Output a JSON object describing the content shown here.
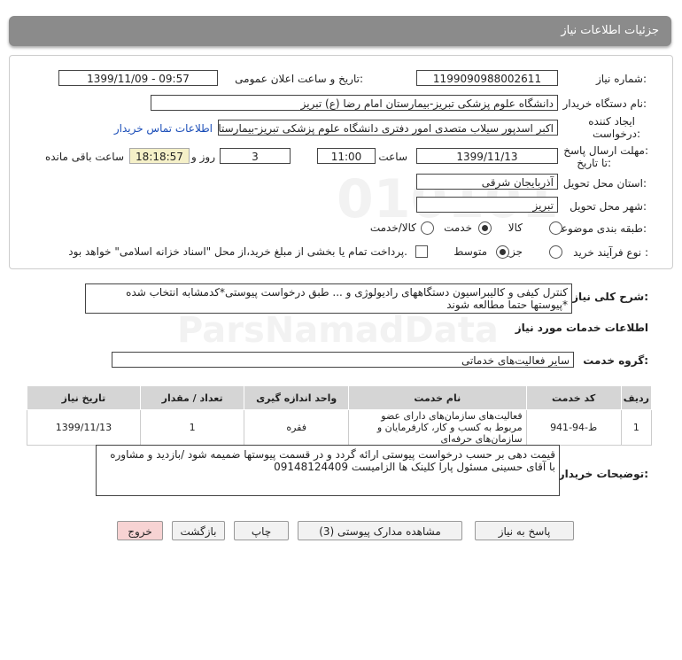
{
  "header": {
    "title": "جزئیات اطلاعات نیاز"
  },
  "fields": {
    "need_number_label": "شماره نیاز:",
    "need_number": "1199090988002611",
    "announce_label": "تاریخ و ساعت اعلان عمومی:",
    "announce_value": "1399/11/09 - 09:57",
    "buyer_label": "نام دستگاه خریدار:",
    "buyer_value": "دانشگاه علوم پزشکی تبریز-بیمارستان امام رضا (ع) تبریز",
    "creator_label_1": "ایجاد کننده",
    "creator_label_2": "درخواست:",
    "creator_value": "اکبر اسدپور سیلاب متصدی امور دفتری دانشگاه علوم پزشکی تبریز-بیمارستان امام",
    "contact_link": "اطلاعات تماس خریدار",
    "deadline_label_1": "مهلت ارسال پاسخ:",
    "deadline_label_2": "تا تاریخ:",
    "deadline_date": "1399/11/13",
    "time_label": "ساعت",
    "deadline_time": "11:00",
    "days_value": "3",
    "days_label": "روز و",
    "remaining_time": "18:18:57",
    "remaining_label": "ساعت باقی مانده",
    "province_label": "استان محل تحویل:",
    "province_value": "آذربایجان شرقی",
    "city_label": "شهر محل تحویل:",
    "city_value": "تبریز",
    "category_label": "طبقه بندی موضوعی:",
    "category_options": [
      "کالا",
      "خدمت",
      "کالا/خدمت"
    ],
    "process_label": "نوع فرآیند خرید :",
    "process_options": [
      "جزیی",
      "متوسط"
    ],
    "payment_text": "پرداخت تمام یا بخشی از مبلغ خرید،از محل \"اسناد خزانه اسلامی\" خواهد بود."
  },
  "description": {
    "label": "شرح کلی نیاز:",
    "line1": "کنترل کیفی و کالیبراسیون دستگاههای رادیولوژی و ... طبق درخواست پیوستی*کدمشابه انتخاب شده",
    "line2": "*پیوستها حتما مطالعه شوند"
  },
  "services_section": "اطلاعات خدمات مورد نیاز",
  "service_group": {
    "label": "گروه خدمت:",
    "value": "سایر فعالیت‌های خدماتی"
  },
  "table": {
    "headers": [
      "ردیف",
      "کد خدمت",
      "نام خدمت",
      "واحد اندازه گیری",
      "تعداد / مقدار",
      "تاریخ نیاز"
    ],
    "rows": [
      [
        "1",
        "ط-94-941",
        "فعالیت‌های سازمان‌های دارای عضو مربوط به کسب و کار، کارفرمایان و سازمان‌های حرفه‌ای",
        "فقره",
        "1",
        "1399/11/13"
      ]
    ]
  },
  "buyer_notes": {
    "label": "توضیحات خریدار:",
    "line1": "قیمت دهی بر حسب درخواست پیوستی ارائه گردد و در قسمت پیوستها ضمیمه شود  /بازدید و مشاوره",
    "line2": "با آقای حسینی مسئول پارا کلینک ها الزامیست      09148124409"
  },
  "buttons": {
    "reply": "پاسخ به نیاز",
    "attachments": "مشاهده مدارک پیوستی (3)",
    "print": "چاپ",
    "back": "بازگشت",
    "exit": "خروج"
  },
  "watermark": {
    "brand": "ParsNamadData",
    "code": "010101"
  }
}
